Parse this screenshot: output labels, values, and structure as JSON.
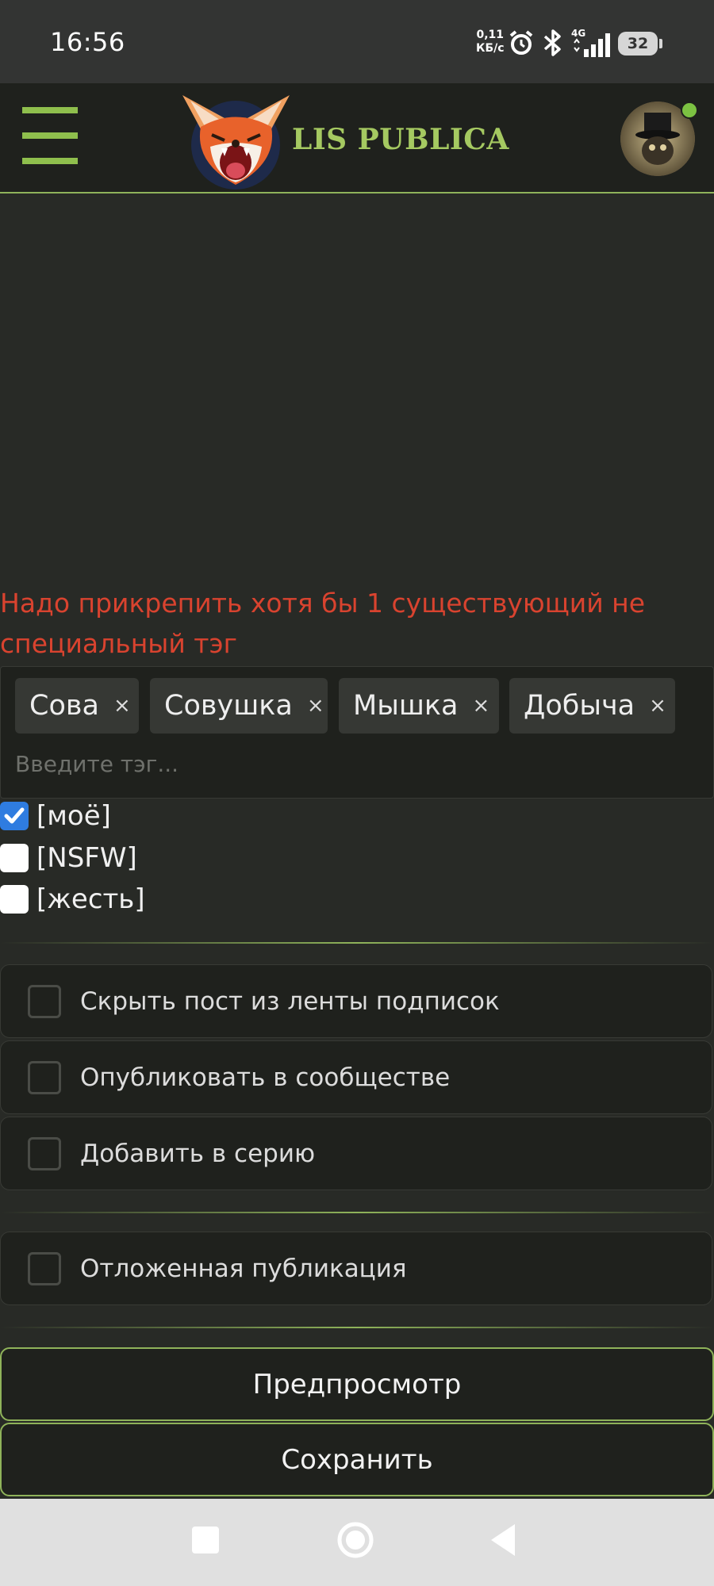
{
  "status_bar": {
    "time": "16:56",
    "net_speed_value": "0,11",
    "net_speed_unit": "КБ/с",
    "network_type": "4G",
    "battery": "32"
  },
  "header": {
    "brand": "LIS PUBLICA",
    "accent_color": "#8fb35a",
    "online": true
  },
  "editor": {
    "error_message": "Надо прикрепить хотя бы 1 существующий не специальный тэг",
    "tags": [
      {
        "label": "Сова",
        "remove": "×"
      },
      {
        "label": "Совушка",
        "remove": "×"
      },
      {
        "label": "Мышка",
        "remove": "×"
      },
      {
        "label": "Добыча",
        "remove": "×"
      }
    ],
    "tag_input_placeholder": "Введите тэг...",
    "special_tags": [
      {
        "label": "[моё]",
        "checked": true
      },
      {
        "label": "[NSFW]",
        "checked": false
      },
      {
        "label": "[жесть]",
        "checked": false
      }
    ],
    "options": [
      {
        "label": "Скрыть пост из ленты подписок",
        "checked": false
      },
      {
        "label": "Опубликовать в сообществе",
        "checked": false
      },
      {
        "label": "Добавить в серию",
        "checked": false
      }
    ],
    "deferred_option": {
      "label": "Отложенная публикация",
      "checked": false
    },
    "preview_button": "Предпросмотр",
    "save_button": "Сохранить"
  },
  "error_color": "#d9432f"
}
